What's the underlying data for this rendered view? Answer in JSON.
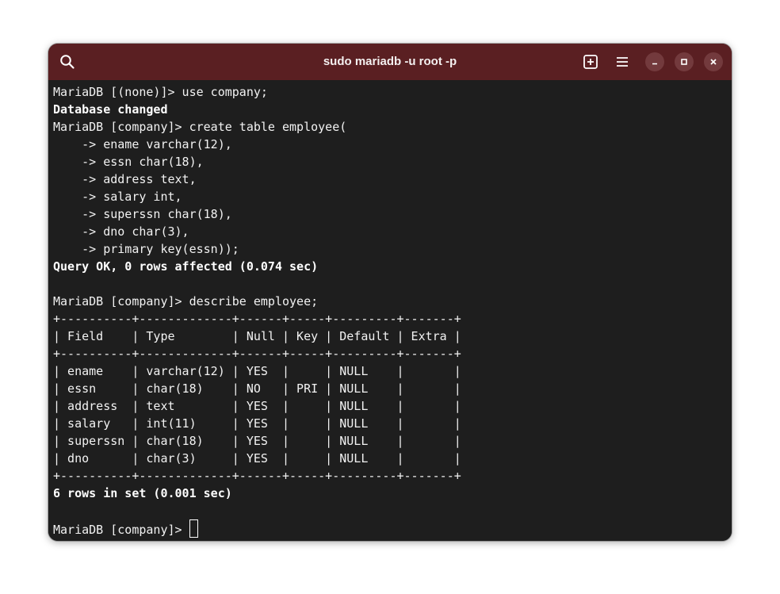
{
  "window": {
    "title": "sudo mariadb -u root -p"
  },
  "titlebar": {
    "buttons": {
      "search": "search-icon",
      "new_tab": "new-tab-icon",
      "menu": "hamburger-menu-icon",
      "minimize": "minimize-icon",
      "maximize": "maximize-icon",
      "close": "close-icon"
    }
  },
  "colors": {
    "titlebar_bg": "#5a1f22",
    "terminal_bg": "#1e1e1e",
    "terminal_fg": "#ffffff"
  },
  "terminal": {
    "lines": [
      {
        "text": "MariaDB [(none)]> use company;",
        "bold": false
      },
      {
        "text": "Database changed",
        "bold": true
      },
      {
        "text": "MariaDB [company]> create table employee(",
        "bold": false
      },
      {
        "text": "    -> ename varchar(12),",
        "bold": false
      },
      {
        "text": "    -> essn char(18),",
        "bold": false
      },
      {
        "text": "    -> address text,",
        "bold": false
      },
      {
        "text": "    -> salary int,",
        "bold": false
      },
      {
        "text": "    -> superssn char(18),",
        "bold": false
      },
      {
        "text": "    -> dno char(3),",
        "bold": false
      },
      {
        "text": "    -> primary key(essn));",
        "bold": false
      },
      {
        "text": "Query OK, 0 rows affected (0.074 sec)",
        "bold": true
      },
      {
        "text": "",
        "bold": false
      },
      {
        "text": "MariaDB [company]> describe employee;",
        "bold": false
      },
      {
        "text": "+----------+-------------+------+-----+---------+-------+",
        "bold": false
      },
      {
        "text": "| Field    | Type        | Null | Key | Default | Extra |",
        "bold": false
      },
      {
        "text": "+----------+-------------+------+-----+---------+-------+",
        "bold": false
      },
      {
        "text": "| ename    | varchar(12) | YES  |     | NULL    |       |",
        "bold": false
      },
      {
        "text": "| essn     | char(18)    | NO   | PRI | NULL    |       |",
        "bold": false
      },
      {
        "text": "| address  | text        | YES  |     | NULL    |       |",
        "bold": false
      },
      {
        "text": "| salary   | int(11)     | YES  |     | NULL    |       |",
        "bold": false
      },
      {
        "text": "| superssn | char(18)    | YES  |     | NULL    |       |",
        "bold": false
      },
      {
        "text": "| dno      | char(3)     | YES  |     | NULL    |       |",
        "bold": false
      },
      {
        "text": "+----------+-------------+------+-----+---------+-------+",
        "bold": false
      },
      {
        "text": "6 rows in set (0.001 sec)",
        "bold": true
      },
      {
        "text": "",
        "bold": false
      }
    ],
    "prompt": "MariaDB [company]> "
  }
}
